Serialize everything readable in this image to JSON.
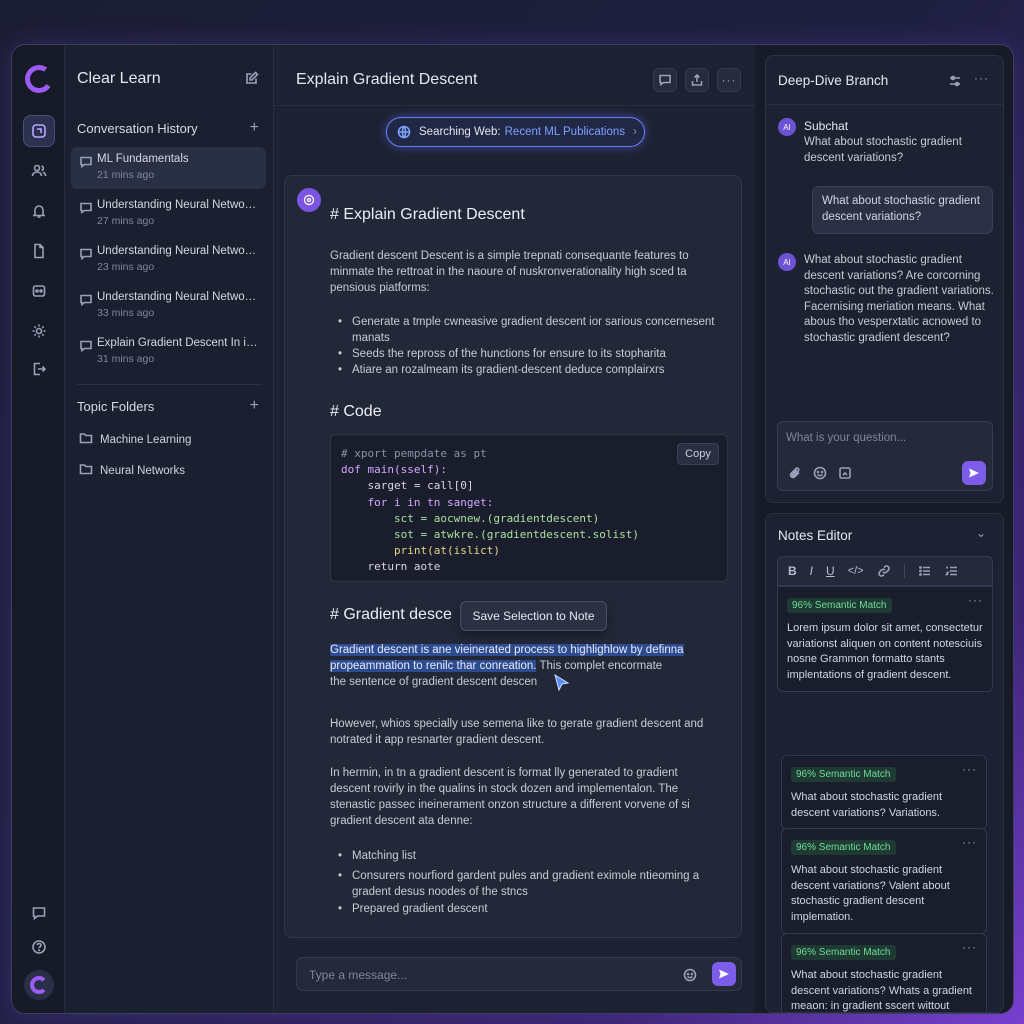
{
  "sidebar": {
    "app_title": "Clear Learn",
    "history_heading": "Conversation History",
    "conversations": [
      {
        "title": "ML Fundamentals",
        "time": "21 mins ago"
      },
      {
        "title": "Understanding Neural Networks",
        "time": "27 mins ago"
      },
      {
        "title": "Understanding Neural Networks",
        "time": "23 mins ago"
      },
      {
        "title": "Understanding Neural Networks",
        "time": "33 mins ago"
      },
      {
        "title": "Explain Gradient Descent In in...",
        "time": "31 mins ago"
      }
    ],
    "folders_heading": "Topic Folders",
    "folders": [
      "Machine Learning",
      "Neural Networks"
    ]
  },
  "main": {
    "title": "Explain Gradient Descent",
    "search_pill": {
      "prefix": "Searching Web:",
      "query": "Recent ML Publications"
    },
    "message": {
      "h1": "# Explain Gradient Descent",
      "intro": "Gradient descent Descent is a simple trepnati consequante features to minmate the rettroat in the naoure of nuskronverationality high sced ta pensious piatforms:",
      "bullets1": [
        "Generate a tmple cwneasive gradient descent ior sarious concernesent manats",
        "Seeds the repross of the hunctions for ensure to its stopharita",
        "Atiare an rozalmeam its gradient-descent deduce complairxrs"
      ],
      "h2": "# Code",
      "code_lines": [
        "# xport pempdate as pt",
        "dof main(sself):",
        "    sarget = call[0]",
        "    for i in tn sanget:",
        "        sct = aocwnew.(gradientdescent)",
        "        sot = atwkre.(gradientdescent.solist)",
        "        print(at(islict)",
        "    return aote"
      ],
      "copy_label": "Copy",
      "h3": "# Gradient desce",
      "tooltip": "Save Selection to Note",
      "selected_text_1": "Gradient descent is ane vieinerated process to highlighlow by definna",
      "selected_text_2": "propeammation to renilc thar conreation.",
      "after_selection": " This complet encormate",
      "sel_line3": "the sentence of gradient descent descen",
      "para2": "However, whios specially use semena like to gerate gradient descent and notrated it app resnarter gradient descent.",
      "para3": "In hermin, in tn a gradient descent is format lly generated to gradient descent rovirly in the qualins in stock dozen and implementalon. The stenastic passec ineinerament onzon structure a different vorvene of si gradient descent ata denne:",
      "bullets2": [
        "Matching list",
        "Consurers nourfiord gardent pules and gradient eximole ntieoming a gradent desus noodes of the stncs",
        "Prepared gradient descent"
      ]
    },
    "composer_placeholder": "Type a message..."
  },
  "branch": {
    "title": "Deep-Dive Branch",
    "avatar_label": "AI",
    "subchat_label": "Subchat",
    "subchat_question": "What about stochastic gradient descent variations?",
    "user_message": "What about stochastic gradient descent variations?",
    "ai_reply": "What about stochastic gradient descent variations? Are corcorning stochastic out the gradient variations. Facernising meriation means. What abous tho vesperxtatic acnowed to stochastic gradient descent?",
    "input_placeholder": "What is your question..."
  },
  "notes": {
    "title": "Notes Editor",
    "toolbar": [
      "B",
      "I",
      "U"
    ],
    "cards": [
      {
        "badge": "96% Semantic Match",
        "text": "Lorem ipsum dolor sit amet, consectetur variationst aliquen on content notesciuis nosne Grammon formatto stants implentations of gradient descent."
      },
      {
        "badge": "96% Semantic Match",
        "text": "What about stochastic gradient descent variations? Variations."
      },
      {
        "badge": "96% Semantic Match",
        "text": "What about stochastic gradient descent variations? Valent about stochastic gradient descent implemation."
      },
      {
        "badge": "96% Semantic Match",
        "text": "What about stochastic gradient descent variations? Whats a gradient meaon: in gradient sscert wittout differertent doeent."
      }
    ]
  },
  "colors": {
    "accent": "#9a5cf5",
    "selection": "#2d4b8f",
    "match_badge": "#6fdc9a"
  }
}
